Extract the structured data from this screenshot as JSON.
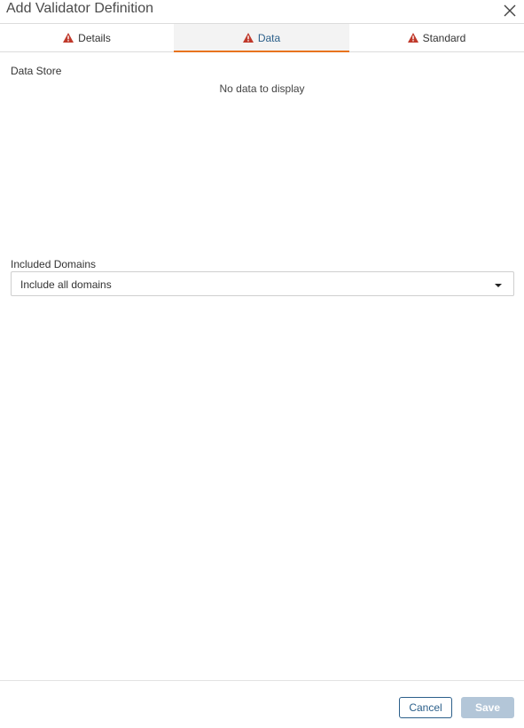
{
  "dialog": {
    "title": "Add Validator Definition"
  },
  "tabs": [
    {
      "label": "Details",
      "icon": "warning-icon",
      "active": false
    },
    {
      "label": "Data",
      "icon": "warning-icon",
      "active": true
    },
    {
      "label": "Standard",
      "icon": "warning-icon",
      "active": false
    }
  ],
  "data_store": {
    "label": "Data Store",
    "empty_text": "No data to display"
  },
  "included_domains": {
    "label": "Included Domains",
    "selected_value": "Include all domains"
  },
  "footer": {
    "cancel_label": "Cancel",
    "save_label": "Save"
  },
  "colors": {
    "accent_tab_underline": "#e8731e",
    "primary": "#2b5f8a",
    "warning": "#c0392b",
    "save_disabled": "#b3c6d8"
  }
}
